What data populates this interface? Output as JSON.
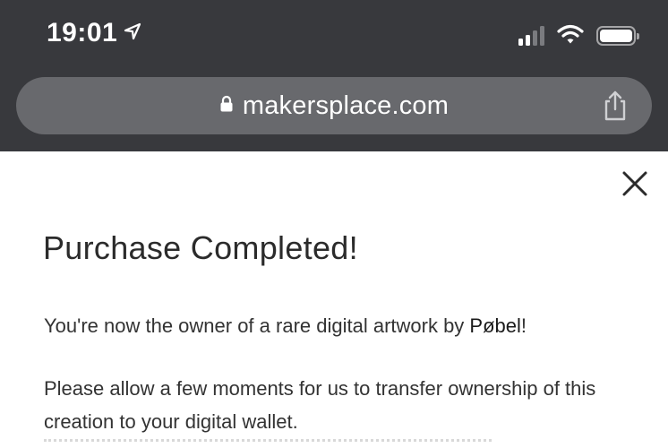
{
  "status_bar": {
    "time": "19:01",
    "colors": {
      "text": "#ffffff",
      "signal_inactive": "#7a7b7f"
    }
  },
  "browser": {
    "url": "makersplace.com",
    "colors": {
      "chrome_bg": "#38393d",
      "url_bar_bg": "#68696d"
    }
  },
  "modal": {
    "title": "Purchase Completed!",
    "ownership_prefix": "You're now the owner of a rare digital artwork by ",
    "artist_name": "Pøbel",
    "ownership_suffix": "!",
    "transfer_text": "Please allow a few moments for us to transfer ownership of this creation to your digital wallet."
  },
  "icons": {
    "location": "location-arrow-icon",
    "signal": "cellular-signal-icon",
    "wifi": "wifi-icon",
    "battery": "battery-icon",
    "lock": "lock-icon",
    "share": "share-icon",
    "close": "close-icon"
  }
}
